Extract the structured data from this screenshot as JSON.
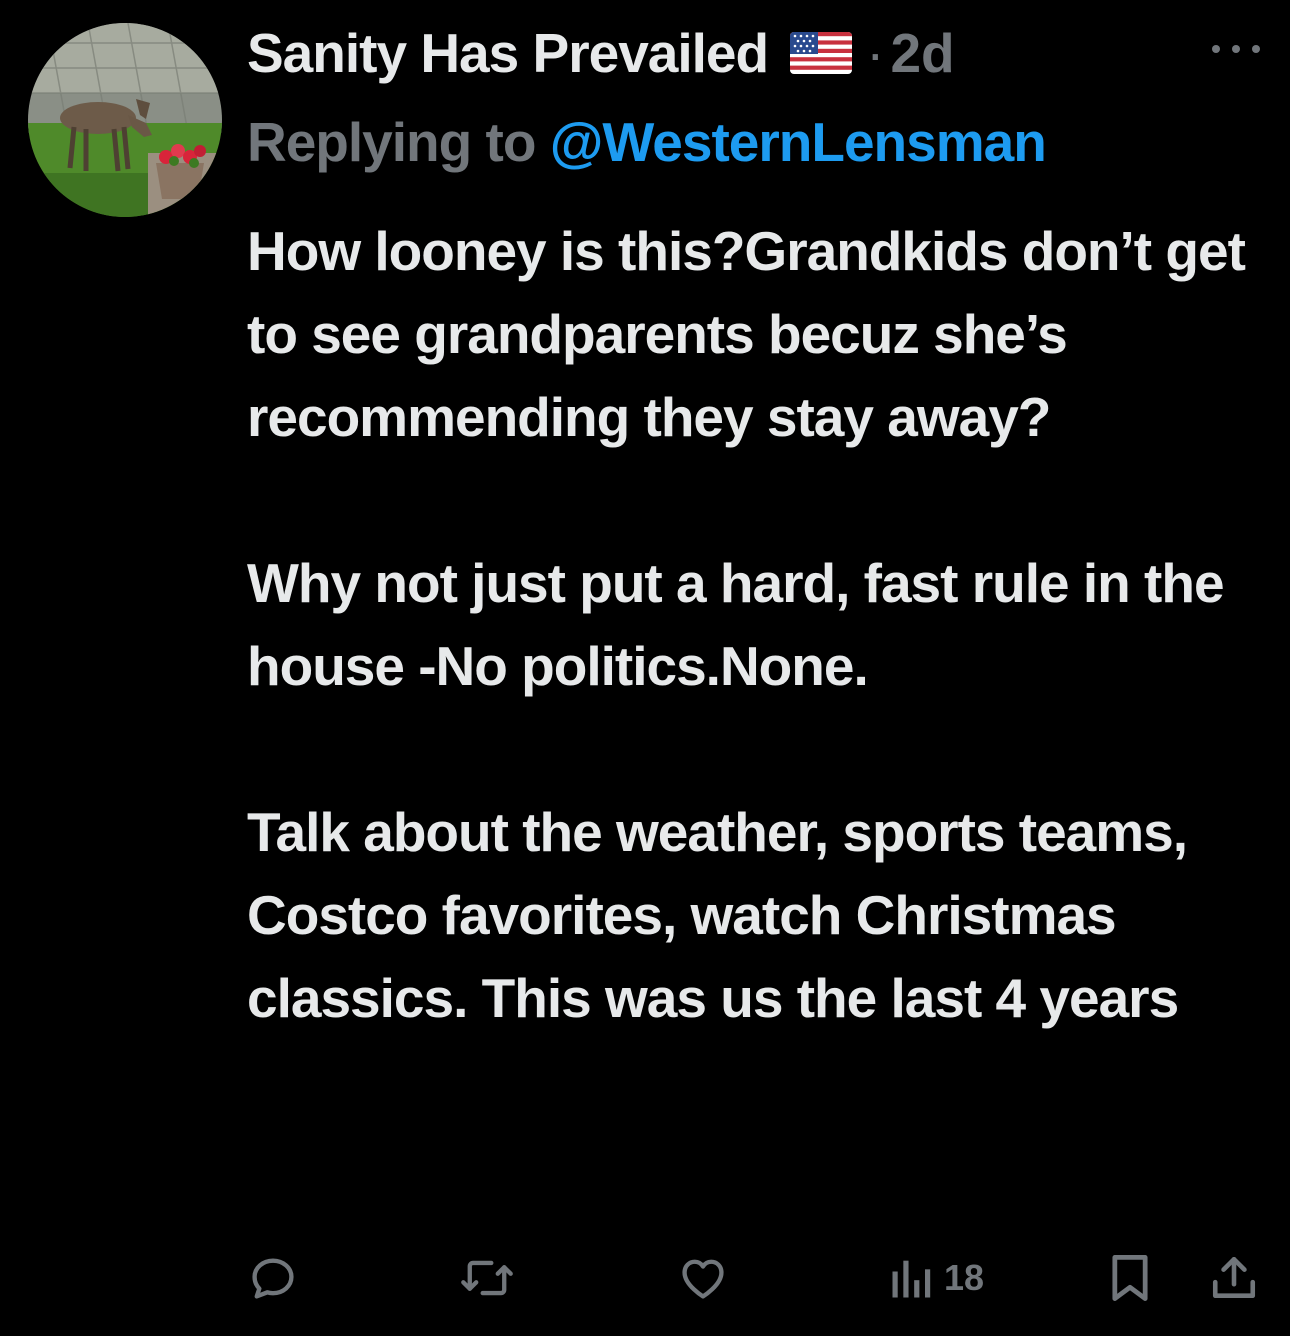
{
  "author": {
    "display_name": "Sanity Has Prevailed",
    "badge_icon": "us-flag-icon",
    "separator": "·",
    "time": "2d",
    "avatar": "deer-photo-avatar"
  },
  "reply": {
    "prefix": "Replying to",
    "mention": "@WesternLensman"
  },
  "tweet_text": {
    "paragraph_1": "How looney is this?Grandkids don’t get to see grandparents becuz she’s recommending they stay away?",
    "paragraph_2": "Why not just put a hard, fast rule in the house -No politics.None.",
    "paragraph_3": "Talk about the weather, sports teams, Costco favorites, watch Christmas classics. This was us the last 4 years"
  },
  "actions": {
    "reply_icon": "reply-icon",
    "retweet_icon": "retweet-icon",
    "like_icon": "like-icon",
    "views_icon": "views-icon",
    "views_count": "18",
    "bookmark_icon": "bookmark-icon",
    "share_icon": "share-icon"
  },
  "colors": {
    "background": "#000000",
    "text": "#e7e9ea",
    "secondary": "#71767b",
    "link": "#1d9bf0"
  }
}
